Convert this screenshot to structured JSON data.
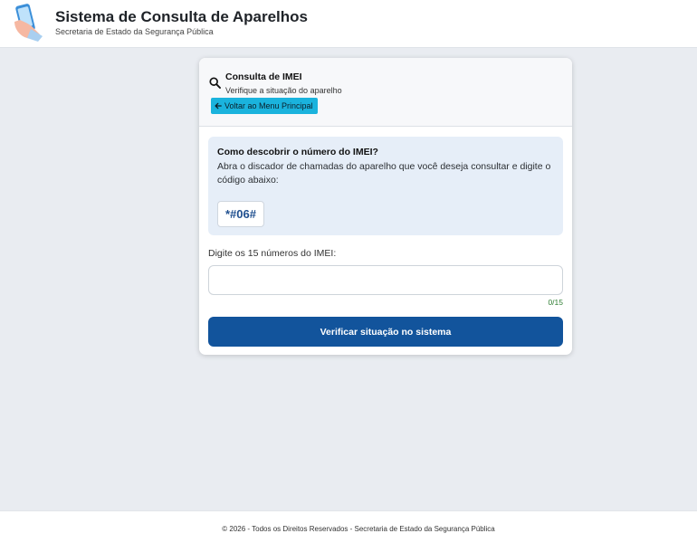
{
  "header": {
    "title": "Sistema de Consulta de Aparelhos",
    "subtitle": "Secretaria de Estado da Segurança Pública",
    "logo_icon": "phone-hand-icon"
  },
  "card": {
    "title": "Consulta de IMEI",
    "subtitle": "Verifique a situação do aparelho",
    "title_icon": "search-icon",
    "back_button_label": "Voltar ao Menu Principal",
    "back_button_icon": "arrow-left-icon",
    "info": {
      "title": "Como descobrir o número do IMEI?",
      "text": "Abra o discador de chamadas do aparelho que você deseja consultar e digite o código abaixo:",
      "code": "*#06#"
    },
    "imei_field": {
      "label": "Digite os 15 números do IMEI:",
      "value": "",
      "placeholder": "",
      "counter": "0/15"
    },
    "verify_button_label": "Verificar situação no sistema"
  },
  "footer": {
    "text": "© 2026 - Todos os Direitos Reservados - Secretaria de Estado da Segurança Pública"
  },
  "colors": {
    "page_background": "#e9ecf1",
    "back_button": "#1ab3dd",
    "verify_button": "#12549c",
    "info_box": "#e6eef8",
    "code_text": "#1f4f8f",
    "counter": "#2e7d32"
  }
}
